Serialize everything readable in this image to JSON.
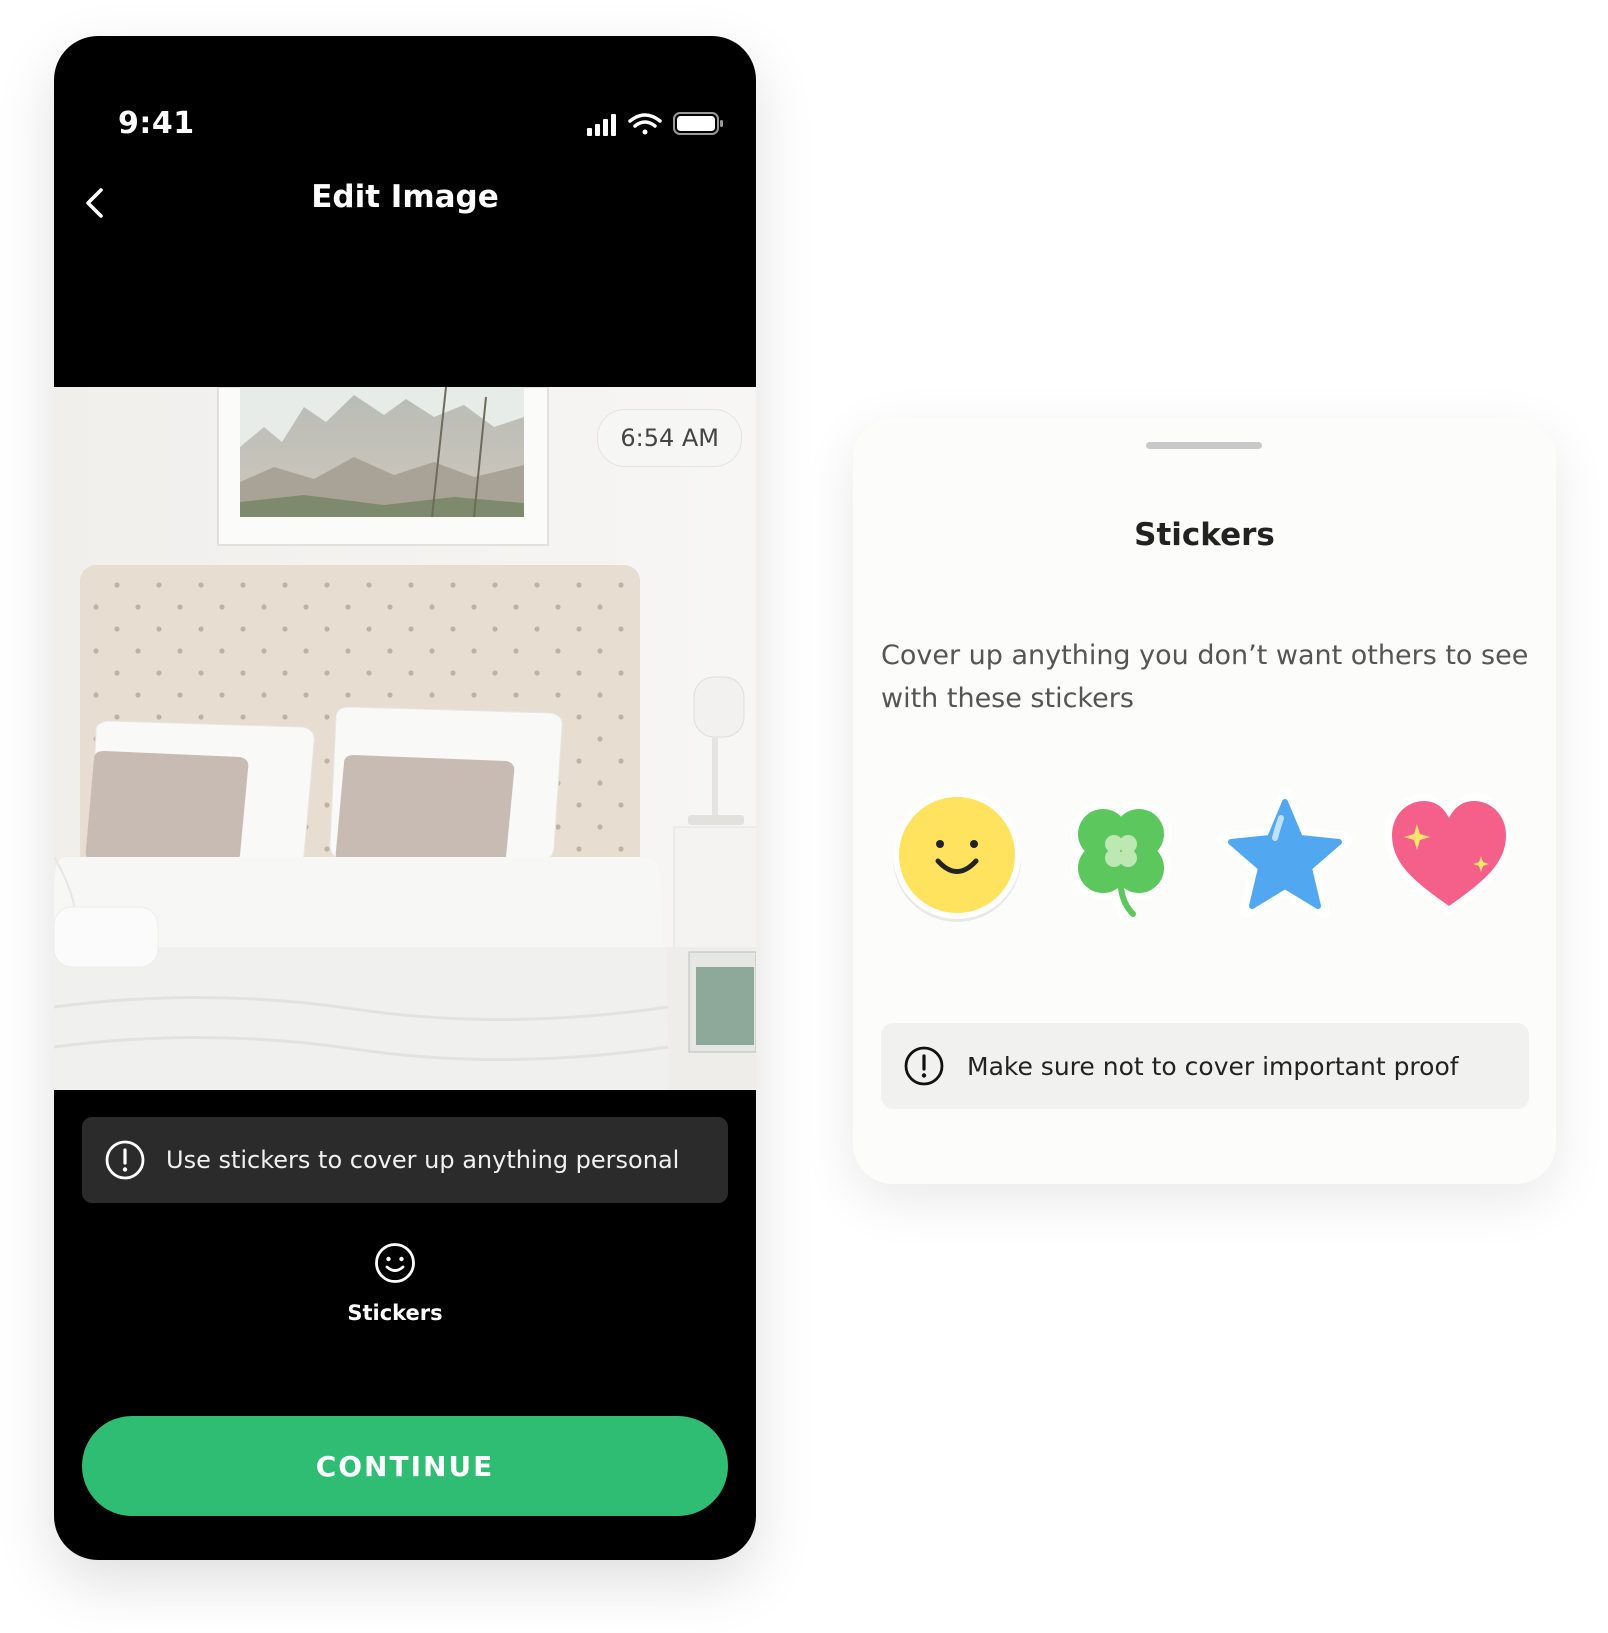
{
  "status_bar": {
    "time": "9:41",
    "icons": [
      "signal-icon",
      "wifi-icon",
      "battery-icon"
    ]
  },
  "nav": {
    "title": "Edit Image",
    "back_icon": "chevron-left-icon"
  },
  "photo": {
    "timestamp": "6:54 AM"
  },
  "tip_dark": {
    "text": "Use stickers to cover up anything personal",
    "icon": "alert-circle-icon"
  },
  "tools": {
    "stickers_label": "Stickers",
    "icon": "smiley-icon"
  },
  "continue_button": {
    "label": "CONTINUE"
  },
  "sheet": {
    "title": "Stickers",
    "description": "Cover up anything you don’t want others to see with these stickers",
    "stickers": [
      "smiley-sticker",
      "clover-sticker",
      "star-sticker",
      "heart-sticker"
    ],
    "tip": {
      "text": "Make sure not to cover important proof",
      "icon": "alert-circle-icon"
    }
  },
  "colors": {
    "accent_green": "#2EBD72",
    "phone_background": "#000000",
    "tip_dark_background": "#2B2B2B",
    "sheet_background": "#FCFCFB",
    "sticker_yellow": "#FFE25E",
    "sticker_green": "#5CC75C",
    "sticker_blue": "#52A8F0",
    "sticker_pink": "#F5608A"
  }
}
